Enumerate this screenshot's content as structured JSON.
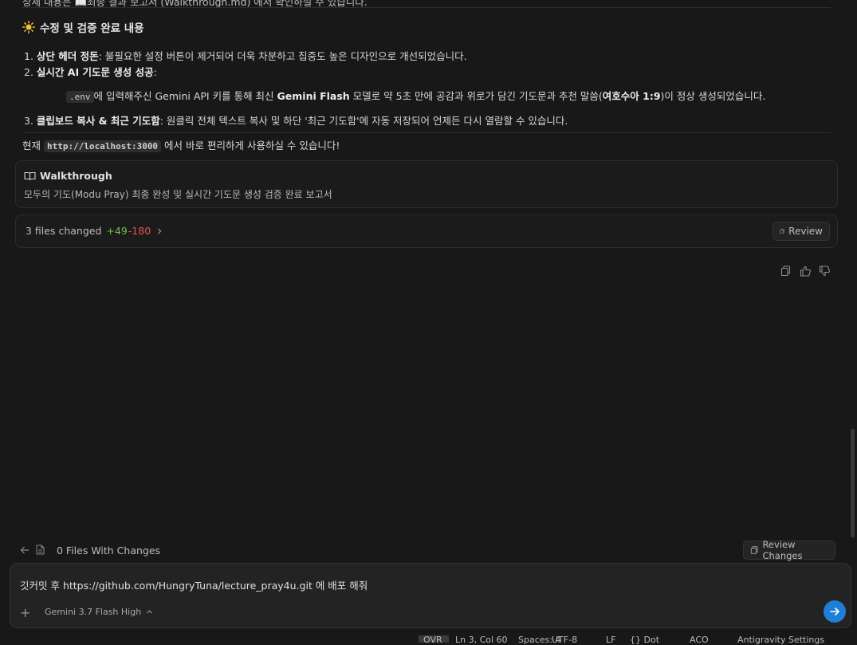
{
  "top_partial_text": "상세 내용은 📖최종 결과 보고서 (Walkthrough.md) 에서 확인하실 수 있습니다.",
  "section": {
    "title": "수정 및 검증 완료 내용",
    "items": [
      {
        "num": "1.",
        "bold": "상단 헤더 정돈",
        "text": ": 불필요한 설정 버튼이 제거되어 더욱 차분하고 집중도 높은 디자인으로 개선되었습니다."
      },
      {
        "num": "2.",
        "bold": "실시간 AI 기도문 생성 성공",
        "text": ":"
      },
      {
        "num": "3.",
        "bold": "클립보드 복사 & 최근 기도함",
        "text": ": 원클릭 전체 텍스트 복사 및 하단 '최근 기도함'에 자동 저장되어 언제든 다시 열람할 수 있습니다."
      }
    ],
    "sub_bullet": {
      "code": ".env",
      "t1": "에 입력해주신 Gemini API 키를 통해 최신 ",
      "b1": "Gemini Flash",
      "t2": " 모델로 약 5초 만에 공감과 위로가 담긴 기도문과 추천 말씀(",
      "b2": "여호수아 1:9",
      "t3": ")이 정상 생성되었습니다."
    }
  },
  "footer_line": {
    "pre": "현재 ",
    "code": "http://localhost:3000",
    "post": " 에서 바로 편리하게 사용하실 수 있습니다!"
  },
  "walkthrough": {
    "title": "Walkthrough",
    "subtitle": "모두의 기도(Modu Pray) 최종 완성 및 실시간 기도문 생성 검증 완료 보고서"
  },
  "changes": {
    "label": "3 files changed",
    "added": "+49",
    "removed": "-180",
    "review_label": "Review"
  },
  "files_bar": {
    "label": "0 Files With Changes",
    "review_changes_label": "Review Changes"
  },
  "input": {
    "value": "깃커밋 후 https://github.com/HungryTuna/lecture_pray4u.git 에 배포 해줘"
  },
  "model": {
    "label": "Gemini 3.7 Flash High"
  },
  "status_bar": [
    "OVR",
    "Ln 3, Col 60",
    "Spaces: 4",
    "UTF-8",
    "LF",
    "{} Dot",
    "ACO",
    "Antigravity Settings"
  ],
  "colors": {
    "accent": "#1d7fd6",
    "added": "#6fbf5f",
    "removed": "#e05555",
    "background": "#181818"
  }
}
